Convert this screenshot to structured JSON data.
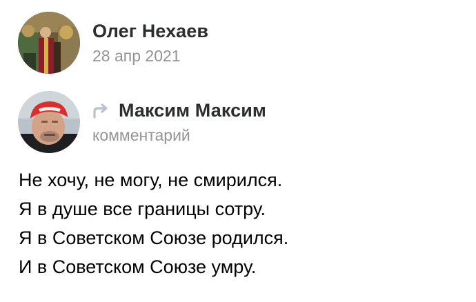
{
  "post": {
    "author_name": "Олег Нехаев",
    "date": "28 апр 2021",
    "avatar_icon": "avatar-church-icon"
  },
  "repost": {
    "author_name": "Максим Максим",
    "label": "комментарий",
    "icon": "share-arrow-icon",
    "icon_color": "#b8c1cc",
    "avatar_icon": "avatar-man-red-cap-icon"
  },
  "text": {
    "lines": [
      "Не хочу, не могу, не смирился.",
      "Я в душе все границы сотру.",
      "Я в Советском Союзе родился.",
      "И в Советском Союзе умру."
    ]
  }
}
